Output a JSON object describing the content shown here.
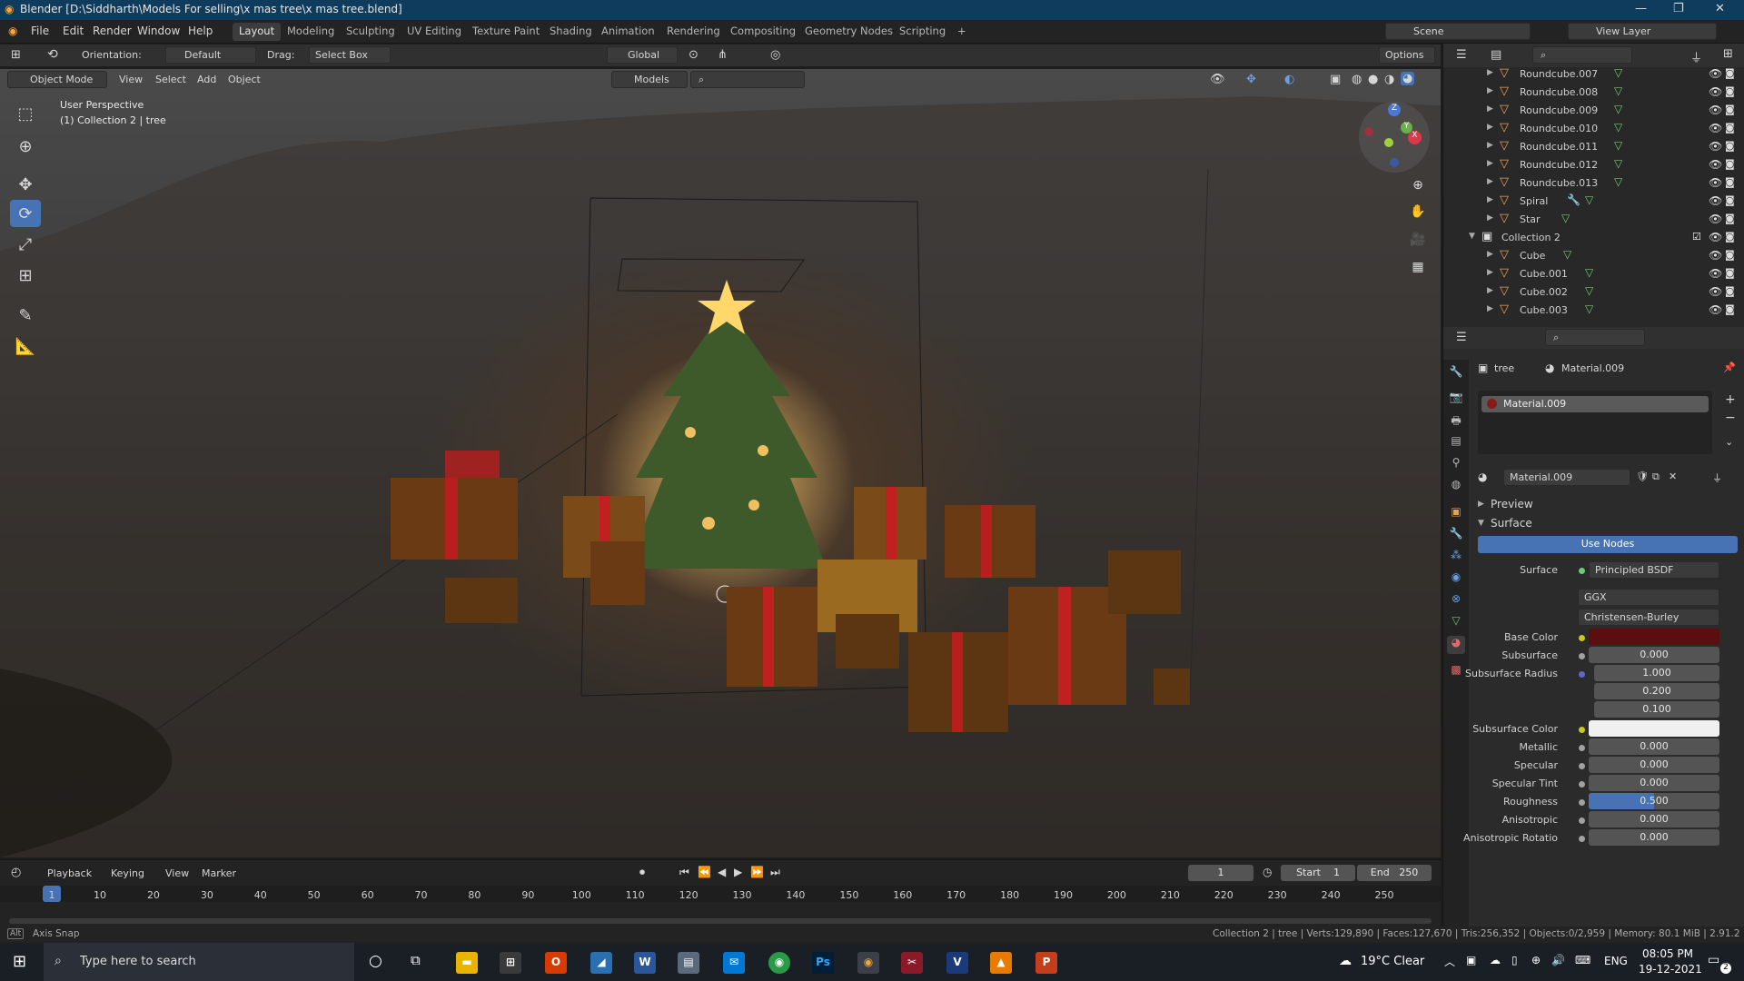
{
  "window": {
    "title": "Blender [D:\\Siddharth\\Models For selling\\x mas tree\\x mas tree.blend]",
    "min": "—",
    "max": "❐",
    "close": "✕"
  },
  "menu": [
    "File",
    "Edit",
    "Render",
    "Window",
    "Help"
  ],
  "workspaces": [
    "Layout",
    "Modeling",
    "Sculpting",
    "UV Editing",
    "Texture Paint",
    "Shading",
    "Animation",
    "Rendering",
    "Compositing",
    "Geometry Nodes",
    "Scripting",
    "+"
  ],
  "scene": {
    "name": "Scene",
    "view_layer": "View Layer"
  },
  "view_header": {
    "orientation_label": "Orientation:",
    "orientation": "Default",
    "drag_label": "Drag:",
    "drag": "Select Box",
    "transform": "Global",
    "options": "Options"
  },
  "view_header2": {
    "mode": "Object Mode",
    "view": "View",
    "select": "Select",
    "add": "Add",
    "object": "Object",
    "collection_filter": "Models"
  },
  "viewport": {
    "perspective": "User Perspective",
    "context": "(1) Collection 2 | tree"
  },
  "gizmo": {
    "z": "Z",
    "y": "Y",
    "x": "X"
  },
  "outliner": {
    "items": [
      {
        "name": "Roundcube.007"
      },
      {
        "name": "Roundcube.008"
      },
      {
        "name": "Roundcube.009"
      },
      {
        "name": "Roundcube.010"
      },
      {
        "name": "Roundcube.011"
      },
      {
        "name": "Roundcube.012"
      },
      {
        "name": "Roundcube.013"
      },
      {
        "name": "Spiral"
      },
      {
        "name": "Star"
      },
      {
        "name": "Collection 2"
      },
      {
        "name": "Cube"
      },
      {
        "name": "Cube.001"
      },
      {
        "name": "Cube.002"
      },
      {
        "name": "Cube.003"
      }
    ]
  },
  "props": {
    "breadcrumb_object": "tree",
    "breadcrumb_material": "Material.009",
    "slot": "Material.009",
    "datablock": "Material.009",
    "panel_preview": "Preview",
    "panel_surface": "Surface",
    "use_nodes": "Use Nodes",
    "surface_label": "Surface",
    "surface_value": "Principled BSDF",
    "distribution": "GGX",
    "subsurface_method": "Christensen-Burley",
    "fields": [
      {
        "label": "Base Color",
        "value": ""
      },
      {
        "label": "Subsurface",
        "value": "0.000"
      },
      {
        "label": "Subsurface Radius",
        "value": "1.000"
      },
      {
        "label": "",
        "value": "0.200"
      },
      {
        "label": "",
        "value": "0.100"
      },
      {
        "label": "Subsurface Color",
        "value": ""
      },
      {
        "label": "Metallic",
        "value": "0.000"
      },
      {
        "label": "Specular",
        "value": "0.000"
      },
      {
        "label": "Specular Tint",
        "value": "0.000"
      },
      {
        "label": "Roughness",
        "value": "0.500"
      },
      {
        "label": "Anisotropic",
        "value": "0.000"
      },
      {
        "label": "Anisotropic Rotatio",
        "value": "0.000"
      }
    ],
    "roughness": 0.5,
    "colors": {
      "base": "#5a0e10",
      "subsurface": "#f0f0f0"
    }
  },
  "timeline": {
    "playback": "Playback",
    "keying": "Keying",
    "view": "View",
    "marker": "Marker",
    "current_frame": "1",
    "start_label": "Start",
    "start": "1",
    "end_label": "End",
    "end": "250",
    "ticks": [
      "1",
      "10",
      "20",
      "30",
      "40",
      "50",
      "60",
      "70",
      "80",
      "90",
      "100",
      "110",
      "120",
      "130",
      "140",
      "150",
      "160",
      "170",
      "180",
      "190",
      "200",
      "210",
      "220",
      "230",
      "240",
      "250"
    ]
  },
  "status": {
    "left": "Axis Snap",
    "right": "Collection 2 | tree | Verts:129,890 | Faces:127,670 | Tris:256,352 | Objects:0/2,959 | Memory: 80.1 MiB | 2.91.2"
  },
  "taskbar": {
    "search_placeholder": "Type here to search",
    "weather": "19°C  Clear",
    "lang": "ENG",
    "time": "08:05 PM",
    "date": "19-12-2021",
    "notif": "2"
  }
}
